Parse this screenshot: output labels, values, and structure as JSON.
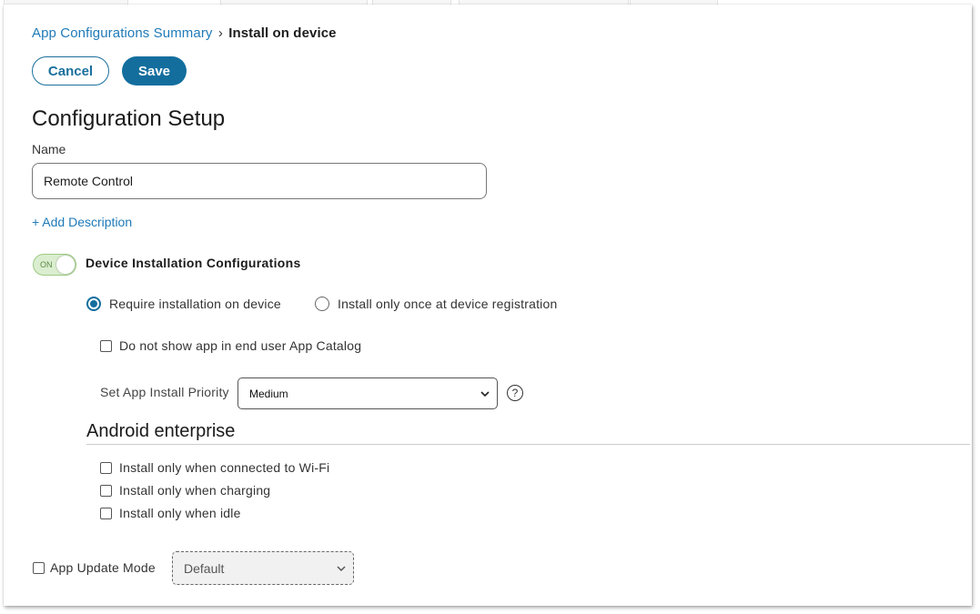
{
  "breadcrumb": {
    "parent": "App Configurations Summary",
    "separator": "›",
    "current": "Install on device"
  },
  "actions": {
    "cancel_label": "Cancel",
    "save_label": "Save"
  },
  "config": {
    "heading": "Configuration Setup",
    "name_label": "Name",
    "name_value": "Remote Control",
    "add_description": "+ Add Description"
  },
  "device_install": {
    "toggle_state": "ON",
    "toggle_on": true,
    "title": "Device Installation Configurations",
    "options": [
      {
        "label": "Require installation on device",
        "selected": true
      },
      {
        "label": "Install only once at device registration",
        "selected": false
      }
    ],
    "hide_in_catalog_label": "Do not show app in end user App Catalog",
    "hide_in_catalog_checked": false,
    "priority_label": "Set App Install Priority",
    "priority_value": "Medium",
    "help_icon": "?"
  },
  "android_enterprise": {
    "heading": "Android enterprise",
    "options": [
      {
        "label": "Install only when connected to Wi-Fi",
        "checked": false
      },
      {
        "label": "Install only when charging",
        "checked": false
      },
      {
        "label": "Install only when idle",
        "checked": false
      }
    ]
  },
  "app_update": {
    "label": "App Update Mode",
    "checked": false,
    "mode_value": "Default"
  },
  "colors": {
    "link": "#1f7ab8",
    "primary": "#136e9e",
    "toggle_bg": "#dbeed0"
  }
}
